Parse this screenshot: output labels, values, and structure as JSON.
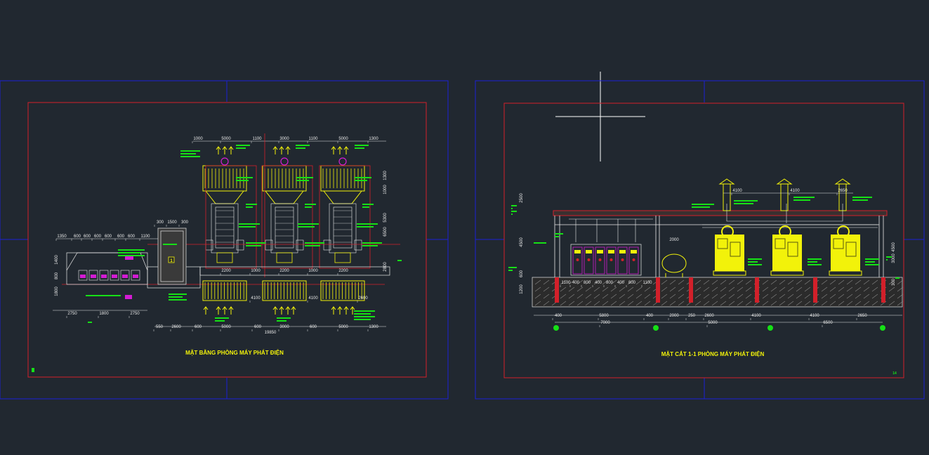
{
  "colors": {
    "background": "#212830",
    "sheet_border": "#1a1fd6",
    "drawing_frame": "#d2202a",
    "equipment": "#f2f20a",
    "annotation": "#16e016",
    "dimension": "#e8e8e8",
    "panel": "#d31cd3"
  },
  "plan_sheet": {
    "title": "MẶT BẰNG PHÒNG MÁY PHÁT ĐIỆN",
    "top_dims": [
      "1000",
      "5000",
      "1100",
      "3000",
      "1100",
      "5000",
      "1300"
    ],
    "bottom_dims": [
      "550",
      "2600",
      "600",
      "5000",
      "600",
      "3000",
      "600",
      "5000",
      "1300"
    ],
    "bottom_total": "19850",
    "left_dims": [
      "2750",
      "1800",
      "2750"
    ],
    "row_dims": [
      "1350",
      "600",
      "600",
      "600",
      "600",
      "600",
      "600",
      "1100"
    ],
    "gen_dims": [
      "2200",
      "1000",
      "2200",
      "1000",
      "2200"
    ],
    "grill_dims": [
      "4100",
      "4100",
      "2600"
    ],
    "side_dims": [
      "2800",
      "6500",
      "1300",
      "5300",
      "1000"
    ],
    "room_dims": [
      "300",
      "1500",
      "300"
    ],
    "vertical_dims": [
      "1400",
      "800",
      "1800"
    ],
    "marker": "1"
  },
  "section_sheet": {
    "title": "MẶT CẮT 1-1 PHÒNG MÁY PHÁT ĐIỆN",
    "top_dims": [
      "4100",
      "4100",
      "2650"
    ],
    "bottom_dims_row1": [
      "400",
      "5800",
      "400",
      "2000",
      "250",
      "2600",
      "4100",
      "4100",
      "2650"
    ],
    "bottom_dims_row2": [
      "7000",
      "5000",
      "6500"
    ],
    "panel_dims": [
      "1100",
      "400",
      "800",
      "400",
      "800",
      "400",
      "800",
      "1100"
    ],
    "left_dims": [
      "2500",
      "4500",
      "600",
      "1200"
    ],
    "right_dims": [
      "4500",
      "3000",
      "300"
    ],
    "tank_dim": "2000",
    "page_marker": "14"
  }
}
